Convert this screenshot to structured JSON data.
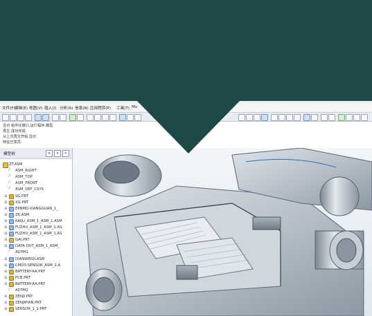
{
  "colors": {
    "banner": "#1d4a47",
    "accent": "#2f6fb3"
  },
  "menubar": {
    "items": [
      "文件(F)",
      "编辑(E)",
      "视图(V)",
      "插入(I)",
      "分析(A)",
      "信息(N)",
      "应用程序(P)",
      "工具(T)",
      "Mo"
    ]
  },
  "messages": {
    "lines": [
      "显示 组件化窗口,运行程序,模型",
      "再生 成功完成.",
      "从上次再生开始,显示",
      "特征已变异."
    ]
  },
  "tree": {
    "title": "模型树",
    "items": [
      {
        "label": "ZT.ASM",
        "kind": "root"
      },
      {
        "label": "ASM_RIGHT",
        "kind": "datum"
      },
      {
        "label": "ASM_TOP",
        "kind": "datum"
      },
      {
        "label": "ASM_FRONT",
        "kind": "datum"
      },
      {
        "label": "ASM_DEF_CSYS",
        "kind": "datum"
      },
      {
        "label": "SG.PRT",
        "kind": "part"
      },
      {
        "label": "XG.PRT",
        "kind": "part"
      },
      {
        "label": "EPNMD-XIANGGUAN_1_",
        "kind": "asm"
      },
      {
        "label": "ZK.ASM",
        "kind": "asm"
      },
      {
        "label": "KAIJU_ASM_1_ASM_1.ASM",
        "kind": "asm"
      },
      {
        "label": "FUZHU_ASM_1_ASM_1.AS",
        "kind": "asm"
      },
      {
        "label": "FUZHU_ASM_1_ASM_1.AS",
        "kind": "asm"
      },
      {
        "label": "GAI.PRT",
        "kind": "part"
      },
      {
        "label": "DATA-OUT_ASM_1_ASM_",
        "kind": "asm"
      },
      {
        "label": "ADTM1",
        "kind": "datum"
      },
      {
        "label": "DIANWEIQI.ASM",
        "kind": "asm"
      },
      {
        "label": "CMOS-SENSOR_ASM_2.A",
        "kind": "asm"
      },
      {
        "label": "BATTERY-AA.PRT",
        "kind": "part"
      },
      {
        "label": "PCB.PRT",
        "kind": "part"
      },
      {
        "label": "BATTERY-AA.PRT",
        "kind": "part"
      },
      {
        "label": "ADTM2",
        "kind": "datum"
      },
      {
        "label": "ZENJI.PRT",
        "kind": "part"
      },
      {
        "label": "ZENJIPIAN.PRT",
        "kind": "part"
      },
      {
        "label": "SENSOR_1_1.PRT",
        "kind": "part"
      }
    ]
  }
}
